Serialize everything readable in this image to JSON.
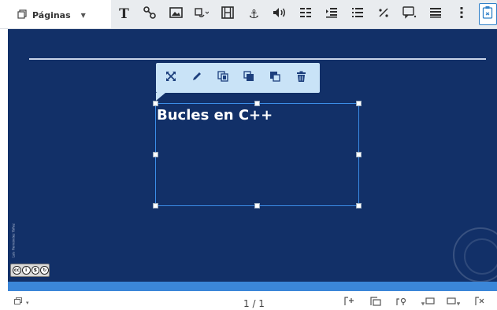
{
  "header": {
    "pages_label": "Páginas"
  },
  "toolbar": {
    "tools": [
      {
        "name": "text-tool",
        "glyph": "T"
      },
      {
        "name": "shapes-tool",
        "glyph": "%"
      },
      {
        "name": "image-tool",
        "glyph": "▣"
      },
      {
        "name": "object-tool",
        "glyph": "⧉"
      },
      {
        "name": "video-tool",
        "glyph": "▦"
      },
      {
        "name": "anchor-tool",
        "glyph": "⚓"
      },
      {
        "name": "audio-tool",
        "glyph": "◀)"
      },
      {
        "name": "align-tool",
        "glyph": "☰"
      },
      {
        "name": "indent-tool",
        "glyph": "⇥"
      },
      {
        "name": "list-tool",
        "glyph": "≡"
      },
      {
        "name": "fraction-tool",
        "glyph": "⁄"
      },
      {
        "name": "comment-tool",
        "glyph": "▭"
      },
      {
        "name": "lines-tool",
        "glyph": "≣"
      },
      {
        "name": "more-tool",
        "glyph": "⋮"
      },
      {
        "name": "paste-tool",
        "glyph": "⎘"
      }
    ]
  },
  "slide": {
    "title": "Bucles en C++",
    "author_vertical": "Luis Hernández Yáñez",
    "license_badge": "cc by nc sa"
  },
  "float_toolbar": {
    "buttons": [
      {
        "name": "expand-icon",
        "glyph": "⤧"
      },
      {
        "name": "edit-icon",
        "glyph": "✎"
      },
      {
        "name": "copy-icon",
        "glyph": "⧉"
      },
      {
        "name": "bring-front-icon",
        "glyph": "▪"
      },
      {
        "name": "send-back-icon",
        "glyph": "▫"
      },
      {
        "name": "delete-icon",
        "glyph": "🗑"
      }
    ]
  },
  "footer": {
    "page_indicator": "1 / 1"
  },
  "colors": {
    "slide_bg": "#123068",
    "accent": "#3b86d8",
    "selection": "#3b8de8"
  }
}
